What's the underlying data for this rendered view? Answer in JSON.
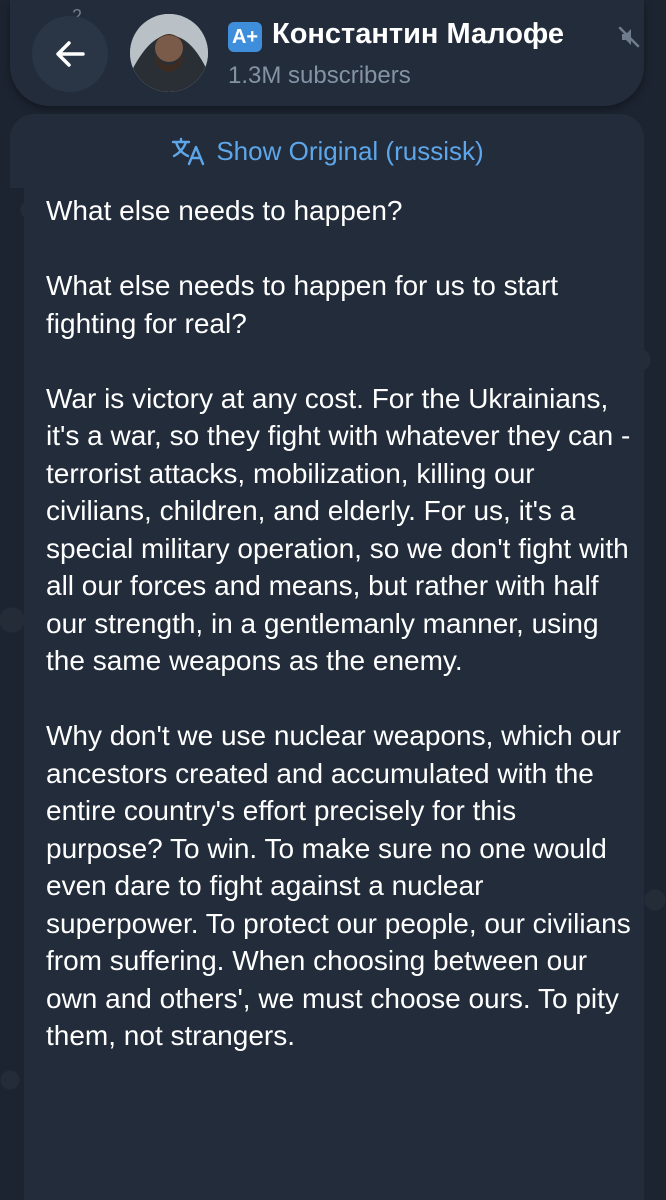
{
  "header": {
    "reactions_count": "2",
    "channel_badge": "A+",
    "channel_name": "Константин Малофе",
    "subscribers": "1.3M subscribers"
  },
  "translate_bar": {
    "label": "Show Original (russisk)"
  },
  "message": {
    "paragraphs": [
      "What else needs to happen?",
      "What else needs to happen for us to start fighting for real?",
      "War is victory at any cost. For the Ukrainians, it's a war, so they fight with whatever they can - terrorist attacks, mobilization, killing our civilians, children, and elderly. For us, it's a special military operation, so we don't fight with all our forces and means, but rather with half our strength, in a gentlemanly manner, using the same weapons as the enemy.",
      "Why don't we use nuclear weapons, which our ancestors created and accumulated with the entire country's effort precisely for this purpose? To win. To make sure no one would even dare to fight against a nuclear superpower. To protect our people, our civilians from suffering. When choosing between our own and others', we must choose ours. To pity them, not strangers."
    ]
  },
  "colors": {
    "background": "#1c2431",
    "surface": "#222c3a",
    "accent": "#5ea6ea",
    "badge": "#3f8edc",
    "muted_text": "#8493a4"
  },
  "icons": {
    "back": "arrow-left-icon",
    "mute": "mute-icon",
    "translate": "translate-icon"
  }
}
